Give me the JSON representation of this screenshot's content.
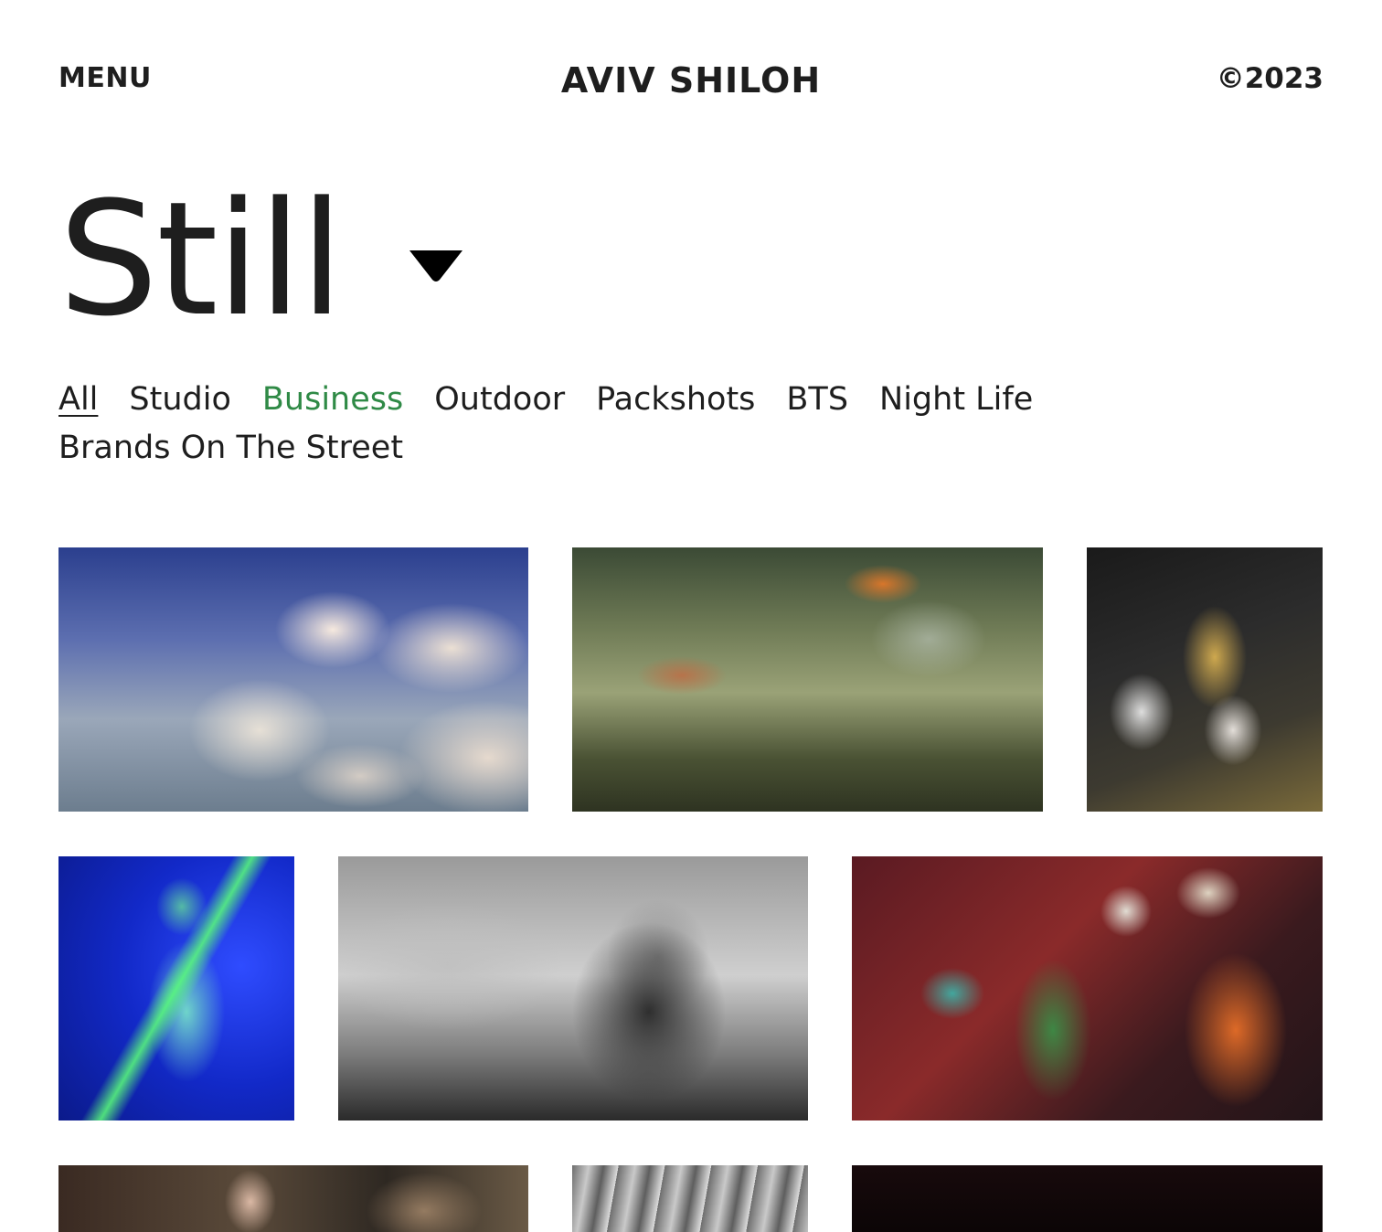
{
  "header": {
    "menu_label": "MENU",
    "brand": "AVIV SHILOH",
    "copyright": "©2023"
  },
  "page": {
    "title": "Still",
    "dropdown_icon": "caret-down-icon"
  },
  "filters": [
    {
      "label": "All",
      "state": "active"
    },
    {
      "label": "Studio",
      "state": "normal"
    },
    {
      "label": "Business",
      "state": "highlighted"
    },
    {
      "label": "Outdoor",
      "state": "normal"
    },
    {
      "label": "Packshots",
      "state": "normal"
    },
    {
      "label": "BTS",
      "state": "normal"
    },
    {
      "label": "Night Life",
      "state": "normal"
    },
    {
      "label": "Brands On The Street",
      "state": "normal"
    }
  ],
  "colors": {
    "text": "#1e1e1e",
    "highlight": "#2f8a46",
    "background": "#ffffff"
  },
  "gallery": [
    {
      "subject": "double exposure clouds and figure"
    },
    {
      "subject": "tree reflection with autumn leaves"
    },
    {
      "subject": "gold carnival mask with black feathers"
    },
    {
      "subject": "woman under green and blue laser light"
    },
    {
      "subject": "black and white bearded man in hood"
    },
    {
      "subject": "colorful holiday window display"
    },
    {
      "subject": "crowd with child"
    },
    {
      "subject": "industrial pipes black and white"
    },
    {
      "subject": "dark night scene"
    }
  ]
}
